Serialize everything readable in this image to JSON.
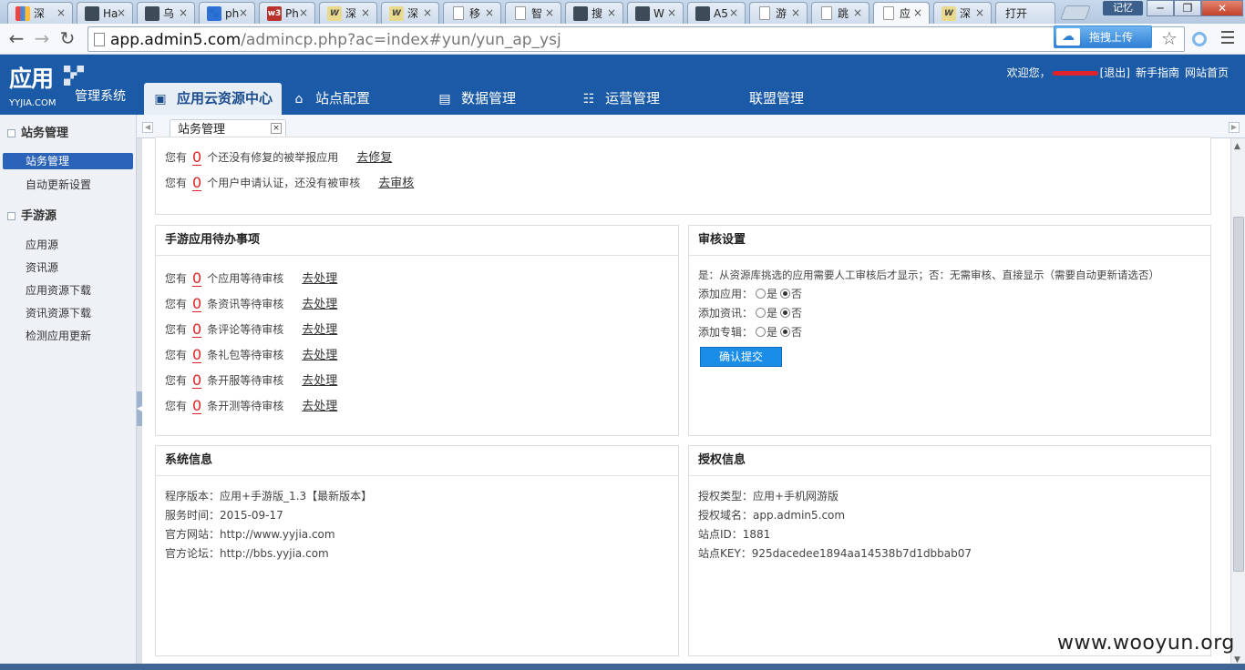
{
  "browser": {
    "tabs": [
      {
        "label": "深",
        "icon": "mx"
      },
      {
        "label": "Ha",
        "icon": "wx"
      },
      {
        "label": "乌",
        "icon": "wx"
      },
      {
        "label": "ph",
        "icon": "bd"
      },
      {
        "label": "Ph",
        "icon": "w3"
      },
      {
        "label": "深",
        "icon": "ww"
      },
      {
        "label": "深",
        "icon": "ww"
      },
      {
        "label": "移",
        "icon": "doc"
      },
      {
        "label": "智",
        "icon": "doc"
      },
      {
        "label": "搜",
        "icon": "wx"
      },
      {
        "label": "W",
        "icon": "wx"
      },
      {
        "label": "A5",
        "icon": "wx"
      },
      {
        "label": "游",
        "icon": "doc"
      },
      {
        "label": "跳",
        "icon": "doc"
      },
      {
        "label": "应",
        "icon": "doc",
        "active": true
      },
      {
        "label": "深",
        "icon": "ww"
      },
      {
        "label": "打开",
        "icon": ""
      }
    ],
    "window_badge": "记忆",
    "min_label": "─",
    "max_label": "❐",
    "close_label": "✕",
    "url_host": "app.admin5.com",
    "url_path": "/admincp.php?ac=index#yun/yun_ap_ysj",
    "ext_label": "拖拽上传",
    "ext_icon": "cloud-icon"
  },
  "header": {
    "logo_cn": "应用",
    "logo_en": "YYJIA.COM",
    "system_title": "管理系统",
    "welcome": "欢迎您，",
    "logout": "[退出]",
    "guide": "新手指南",
    "home": "网站首页",
    "menu": [
      {
        "label": "应用云资源中心",
        "icon": "▣",
        "active": true
      },
      {
        "label": "站点配置",
        "icon": "⌂"
      },
      {
        "label": "数据管理",
        "icon": "▤"
      },
      {
        "label": "运营管理",
        "icon": "☷"
      },
      {
        "label": "联盟管理",
        "icon": ""
      }
    ]
  },
  "sidebar": {
    "groups": [
      {
        "title": "站务管理",
        "items": [
          "站务管理",
          "自动更新设置"
        ],
        "active_index": 0
      },
      {
        "title": "手游源",
        "items": [
          "应用源",
          "资讯源",
          "应用资源下载",
          "资讯资源下载",
          "检测应用更新"
        ]
      }
    ]
  },
  "page_tab": {
    "label": "站务管理",
    "close": "×"
  },
  "top_panel": {
    "rows": [
      {
        "prefix": "您有",
        "count": "0",
        "text": "个还没有修复的被举报应用",
        "action": "去修复"
      },
      {
        "prefix": "您有",
        "count": "0",
        "text": "个用户申请认证，还没有被审核",
        "action": "去审核"
      }
    ]
  },
  "todo_panel": {
    "title": "手游应用待办事项",
    "rows": [
      {
        "prefix": "您有",
        "count": "0",
        "text": "个应用等待审核",
        "action": "去处理"
      },
      {
        "prefix": "您有",
        "count": "0",
        "text": "条资讯等待审核",
        "action": "去处理"
      },
      {
        "prefix": "您有",
        "count": "0",
        "text": "条评论等待审核",
        "action": "去处理"
      },
      {
        "prefix": "您有",
        "count": "0",
        "text": "条礼包等待审核",
        "action": "去处理"
      },
      {
        "prefix": "您有",
        "count": "0",
        "text": "条开服等待审核",
        "action": "去处理"
      },
      {
        "prefix": "您有",
        "count": "0",
        "text": "条开测等待审核",
        "action": "去处理"
      }
    ]
  },
  "review_panel": {
    "title": "审核设置",
    "description": "是：从资源库挑选的应用需要人工审核后才显示；否：无需审核、直接显示（需要自动更新请选否）",
    "options": [
      {
        "label": "添加应用：",
        "yes": "是",
        "no": "否",
        "selected": "no"
      },
      {
        "label": "添加资讯：",
        "yes": "是",
        "no": "否",
        "selected": "no"
      },
      {
        "label": "添加专辑：",
        "yes": "是",
        "no": "否",
        "selected": "no"
      }
    ],
    "submit": "确认提交"
  },
  "system_panel": {
    "title": "系统信息",
    "lines": [
      "程序版本：应用+手游版_1.3【最新版本】",
      "服务时间：2015-09-17",
      "官方网站：http://www.yyjia.com",
      "官方论坛：http://bbs.yyjia.com"
    ]
  },
  "license_panel": {
    "title": "授权信息",
    "lines": [
      "授权类型：应用+手机网游版",
      "授权域名：app.admin5.com",
      "站点ID：1881",
      "站点KEY：925dacedee1894aa14538b7d1dbbab07"
    ]
  },
  "watermark": "www.wooyun.org"
}
